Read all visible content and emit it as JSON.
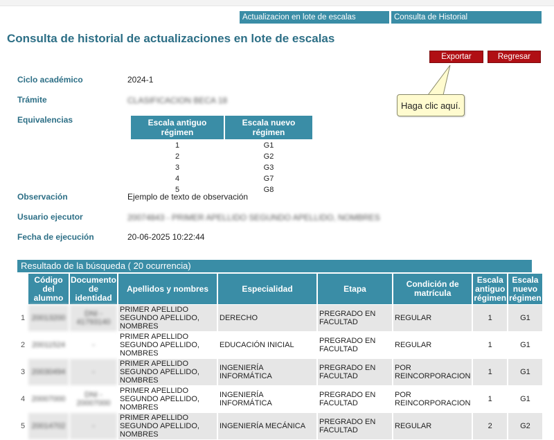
{
  "tabs": [
    "Actualizacion en lote de escalas",
    "Consulta de Historial"
  ],
  "page_title": "Consulta de historial de actualizaciones en lote de escalas",
  "buttons": {
    "export": "Exportar",
    "back": "Regresar"
  },
  "tooltip": "Haga clic aquí.",
  "fields": {
    "ciclo": {
      "label": "Ciclo académico",
      "value": "2024-1"
    },
    "tramite": {
      "label": "Trámite",
      "value": "CLASIFICACION BECA 18"
    },
    "equivalencias": {
      "label": "Equivalencias"
    },
    "observacion": {
      "label": "Observación",
      "value": "Ejemplo de texto de observación"
    },
    "usuario": {
      "label": "Usuario ejecutor",
      "value": "20074843 - PRIMER APELLIDO SEGUNDO APELLIDO, NOMBRES"
    },
    "fecha": {
      "label": "Fecha de ejecución",
      "value": "20-06-2025 10:22:44"
    }
  },
  "equivalencias_table": {
    "headers": [
      "Escala antiguo régimen",
      "Escala nuevo régimen"
    ],
    "rows": [
      [
        "1",
        "G1"
      ],
      [
        "2",
        "G2"
      ],
      [
        "3",
        "G3"
      ],
      [
        "4",
        "G7"
      ],
      [
        "5",
        "G8"
      ]
    ]
  },
  "results": {
    "header": "Resultado de la búsqueda ( 20 ocurrencia)",
    "columns": [
      "",
      "Código del alumno",
      "Documento de identidad",
      "Apellidos y nombres",
      "Especialidad",
      "Etapa",
      "Condición de matrícula",
      "Escala antiguo régimen",
      "Escala nuevo régimen"
    ],
    "rows": [
      [
        "1",
        "20013200",
        "DNI - 41793140",
        "PRIMER APELLIDO SEGUNDO APELLIDO, NOMBRES",
        "DERECHO",
        "PREGRADO EN FACULTAD",
        "REGULAR",
        "1",
        "G1"
      ],
      [
        "2",
        "20011524",
        "-",
        "PRIMER APELLIDO SEGUNDO APELLIDO, NOMBRES",
        "EDUCACIÓN INICIAL",
        "PREGRADO EN FACULTAD",
        "REGULAR",
        "1",
        "G1"
      ],
      [
        "3",
        "20030494",
        "-",
        "PRIMER APELLIDO SEGUNDO APELLIDO, NOMBRES",
        "INGENIERÍA INFORMÁTICA",
        "PREGRADO EN FACULTAD",
        "POR REINCORPORACION",
        "1",
        "G1"
      ],
      [
        "4",
        "20007000",
        "DNI - 20007000",
        "PRIMER APELLIDO SEGUNDO APELLIDO, NOMBRES",
        "INGENIERÍA INFORMÁTICA",
        "PREGRADO EN FACULTAD",
        "POR REINCORPORACION",
        "1",
        "G1"
      ],
      [
        "5",
        "20014702",
        "-",
        "PRIMER APELLIDO SEGUNDO APELLIDO, NOMBRES",
        "INGENIERÍA MECÁNICA",
        "PREGRADO EN FACULTAD",
        "REGULAR",
        "2",
        "G2"
      ]
    ]
  }
}
